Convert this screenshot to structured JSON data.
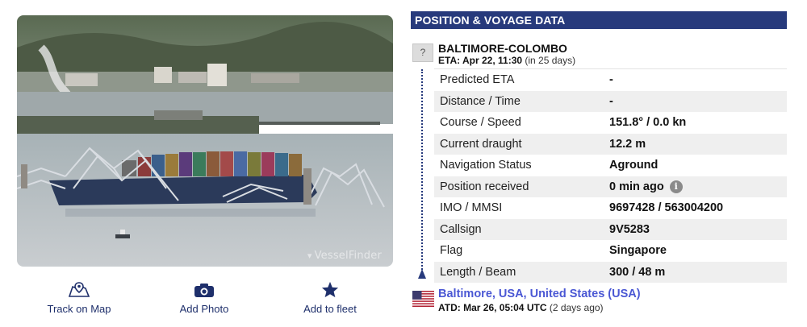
{
  "photo": {
    "watermark": "VesselFinder",
    "alt": "vessel-photo"
  },
  "actions": [
    {
      "label": "Track on Map",
      "icon": "map-pin-icon"
    },
    {
      "label": "Add Photo",
      "icon": "camera-icon"
    },
    {
      "label": "Add to fleet",
      "icon": "star-icon"
    }
  ],
  "panel": {
    "title": "POSITION & VOYAGE DATA",
    "destination": {
      "badge": "?",
      "name": "BALTIMORE-COLOMBO",
      "eta_label": "ETA: Apr 22, 11:30",
      "eta_relative": "(in 25 days)"
    },
    "rows": [
      {
        "key": "Predicted ETA",
        "value": "-"
      },
      {
        "key": "Distance / Time",
        "value": "-"
      },
      {
        "key": "Course / Speed",
        "value": "151.8° / 0.0 kn"
      },
      {
        "key": "Current draught",
        "value": "12.2 m"
      },
      {
        "key": "Navigation Status",
        "value": "Aground"
      },
      {
        "key": "Position received",
        "value": "0 min ago",
        "info": "i"
      },
      {
        "key": "IMO / MMSI",
        "value": "9697428 / 563004200"
      },
      {
        "key": "Callsign",
        "value": "9V5283"
      },
      {
        "key": "Flag",
        "value": "Singapore"
      },
      {
        "key": "Length / Beam",
        "value": "300 / 48 m"
      }
    ],
    "origin": {
      "port": "Baltimore, USA, United States (USA)",
      "atd_label": "ATD: Mar 26, 05:04 UTC",
      "atd_relative": "(2 days ago)",
      "flag_icon": "us-flag-icon"
    }
  },
  "colors": {
    "header_bg": "#273a7c",
    "link": "#4a57d4",
    "action_text": "#1e2f6b",
    "row_stripe": "#efefef"
  }
}
